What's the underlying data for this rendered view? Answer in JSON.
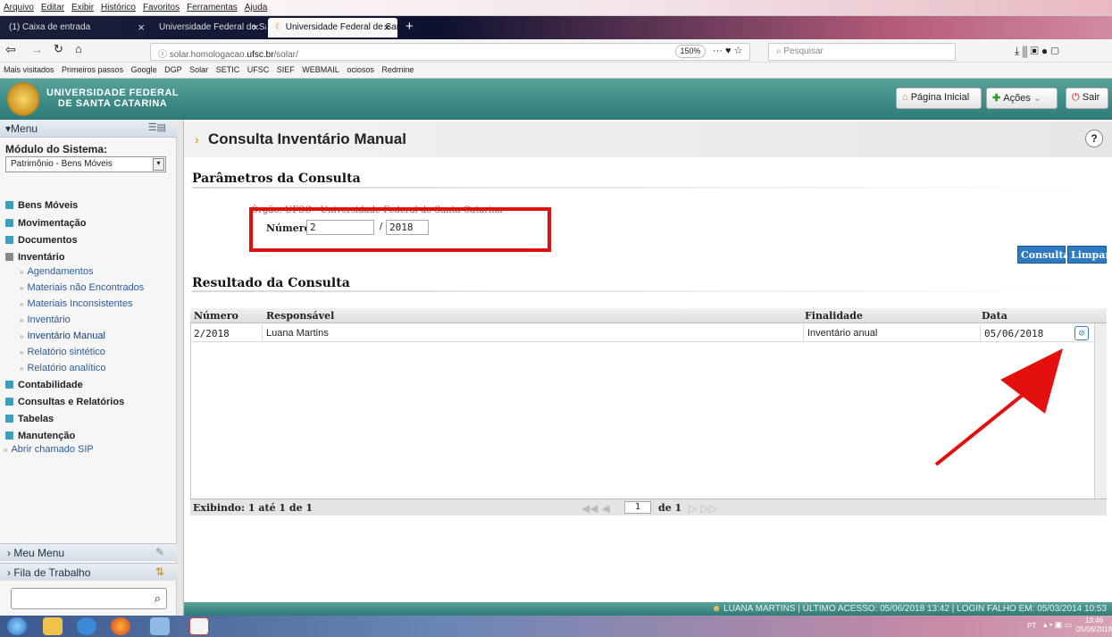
{
  "browser": {
    "menu": [
      "Arquivo",
      "Editar",
      "Exibir",
      "Histórico",
      "Favoritos",
      "Ferramentas",
      "Ajuda"
    ],
    "tabs": [
      {
        "label": "(1) Caixa de entrada"
      },
      {
        "label": "Universidade Federal de Santa"
      },
      {
        "label": "Universidade Federal de Santa"
      }
    ],
    "url_prefix": "solar.homologacao.",
    "url_domain": "ufsc.br",
    "url_path": "/solar/",
    "zoom": "150%",
    "search_placeholder": "Pesquisar",
    "bookmarks": [
      "Mais visitados",
      "Primeiros passos",
      "Google",
      "DGP",
      "Solar",
      "SETIC",
      "UFSC",
      "SIEF",
      "WEBMAIL",
      "ociosos",
      "Redmine"
    ]
  },
  "header": {
    "university_line1": "UNIVERSIDADE FEDERAL",
    "university_line2": "DE SANTA CATARINA",
    "home_label": "Página Inicial",
    "actions_label": "Ações",
    "exit_label": "Sair"
  },
  "sidebar": {
    "menu_label": "Menu",
    "module_label": "Módulo do Sistema:",
    "module_value": "Patrimônio - Bens Móveis",
    "items": [
      {
        "label": "Bens Móveis"
      },
      {
        "label": "Movimentação"
      },
      {
        "label": "Documentos"
      },
      {
        "label": "Inventário"
      }
    ],
    "sub_items": [
      {
        "label": "Agendamentos"
      },
      {
        "label": "Materiais não Encontrados"
      },
      {
        "label": "Materiais Inconsistentes"
      },
      {
        "label": "Inventário"
      },
      {
        "label": "Inventário Manual"
      },
      {
        "label": "Relatório sintético"
      },
      {
        "label": "Relatório analítico"
      }
    ],
    "items2": [
      {
        "label": "Contabilidade"
      },
      {
        "label": "Consultas e Relatórios"
      },
      {
        "label": "Tabelas"
      },
      {
        "label": "Manutenção"
      }
    ],
    "sip_label": "Abrir chamado SIP",
    "my_menu": "Meu Menu",
    "work_queue": "Fila de Trabalho"
  },
  "page": {
    "title": "Consulta Inventário Manual",
    "params_title": "Parâmetros da Consulta",
    "orgao_label": "Órgão: UFSC - Universidade Federal de Santa Catarina",
    "numero_label": "Número:",
    "numero_value": "2",
    "separator": "/",
    "year_value": "2018",
    "consultar": "Consultar",
    "limpar": "Limpar",
    "result_title": "Resultado da Consulta",
    "columns": [
      "Número",
      "Responsável",
      "Finalidade",
      "Data"
    ],
    "rows": [
      {
        "numero": "2/2018",
        "responsavel": "Luana Martins",
        "finalidade": "Inventário anual",
        "data": "05/06/2018"
      }
    ],
    "showing": "Exibindo: 1 até 1 de 1",
    "page_num": "1",
    "page_of": "de 1"
  },
  "status": {
    "text": "LUANA MARTINS  |  ÚLTIMO ACESSO: 05/06/2018 13:42  |  LOGIN FALHO EM: 05/03/2014 10:53"
  },
  "taskbar": {
    "lang": "PT",
    "time": "13:46",
    "date": "05/06/2018"
  }
}
